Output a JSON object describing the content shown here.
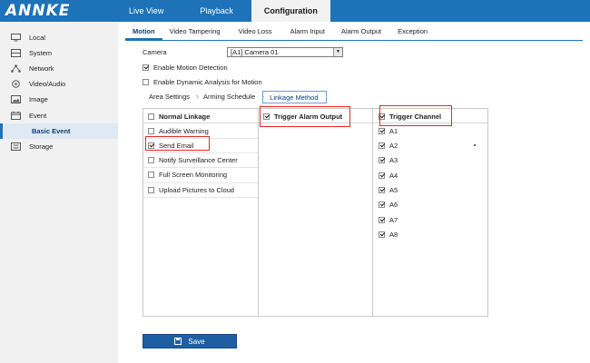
{
  "brand": {
    "logo": "ANNKE",
    "top_color": "#1e73b8"
  },
  "topnav": [
    "Live View",
    "Playback",
    "Configuration"
  ],
  "sidebar": {
    "items": [
      {
        "label": "Local",
        "icon": "monitor-icon"
      },
      {
        "label": "System",
        "icon": "server-icon"
      },
      {
        "label": "Network",
        "icon": "network-icon"
      },
      {
        "label": "Video/Audio",
        "icon": "video-audio-icon"
      },
      {
        "label": "Image",
        "icon": "image-icon"
      },
      {
        "label": "Event",
        "icon": "calendar-icon"
      },
      {
        "label": "Basic Event",
        "icon": ""
      },
      {
        "label": "Storage",
        "icon": "storage-icon"
      }
    ]
  },
  "subtabs": [
    "Motion",
    "Video Tampering",
    "Video Loss",
    "Alarm Input",
    "Alarm Output",
    "Exception"
  ],
  "camera": {
    "label": "Camera",
    "value": "[A1] Camera 01"
  },
  "options": {
    "enable_motion": "Enable Motion Detection",
    "enable_dynamic": "Enable Dynamic Analysis for Motion"
  },
  "steps": [
    "Area Settings",
    "Arming Schedule",
    "Linkage Method"
  ],
  "linkage": {
    "normal_header": "Normal Linkage",
    "normal_items": [
      "Audible Warning",
      "Send Email",
      "Notify Surveillance Center",
      "Full Screen Monitoring",
      "Upload Pictures to Cloud"
    ],
    "alarm_header": "Trigger Alarm Output",
    "channel_header": "Trigger Channel",
    "channels": [
      "A1",
      "A2",
      "A3",
      "A4",
      "A5",
      "A6",
      "A7",
      "A8"
    ]
  },
  "save_label": "Save"
}
